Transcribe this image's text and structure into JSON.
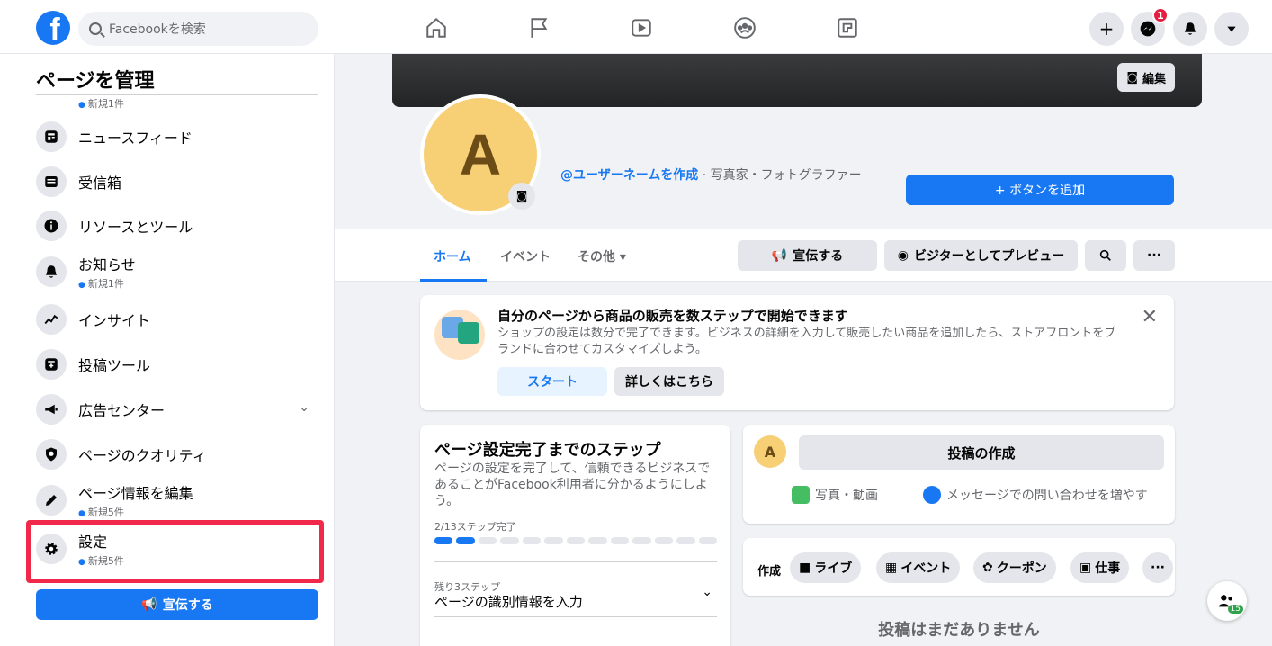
{
  "topbar": {
    "search_placeholder": "Facebookを検索",
    "messenger_badge": "1"
  },
  "sidebar": {
    "title": "ページを管理",
    "top_sub": "新規1件",
    "items": [
      {
        "label": "ニュースフィード",
        "sub": ""
      },
      {
        "label": "受信箱",
        "sub": ""
      },
      {
        "label": "リソースとツール",
        "sub": ""
      },
      {
        "label": "お知らせ",
        "sub": "新規1件"
      },
      {
        "label": "インサイト",
        "sub": ""
      },
      {
        "label": "投稿ツール",
        "sub": ""
      },
      {
        "label": "広告センター",
        "sub": ""
      },
      {
        "label": "ページのクオリティ",
        "sub": ""
      },
      {
        "label": "ページ情報を編集",
        "sub": "新規5件"
      },
      {
        "label": "設定",
        "sub": "新規5件"
      }
    ],
    "promote_label": "宣伝する"
  },
  "profile": {
    "edit_cover_label": "編集",
    "avatar_letter": "A",
    "username_link": "@ユーザーネームを作成",
    "category": " · 写真家・フォトグラファー",
    "add_button_label": "+ ボタンを追加",
    "tabs": [
      "ホーム",
      "イベント",
      "その他 ▾"
    ],
    "actions": {
      "promote": "宣伝する",
      "preview": "ビジターとしてプレビュー",
      "more": "···"
    }
  },
  "shop_card": {
    "title": "自分のページから商品の販売を数ステップで開始できます",
    "description": "ショップの設定は数分で完了できます。ビジネスの詳細を入力して販売したい商品を追加したら、ストアフロントをブランドに合わせてカスタマイズしよう。",
    "start_label": "スタート",
    "more_label": "詳しくはこちら"
  },
  "steps_card": {
    "title": "ページ設定完了までのステップ",
    "description": "ページの設定を完了して、信頼できるビジネスであることがFacebook利用者に分かるようにしよう。",
    "progress_text": "2/13ステップ完了",
    "steps_done": 2,
    "steps_total": 13,
    "remaining_label": "残り3ステップ",
    "remaining_value": "ページの識別情報を入力"
  },
  "composer": {
    "avatar_letter": "A",
    "prompt": "投稿の作成",
    "photo_video": "写真・動画",
    "messages": "メッセージでの問い合わせを増やす"
  },
  "create_bar": {
    "label": "作成",
    "live": "ライブ",
    "event": "イベント",
    "coupon": "クーポン",
    "job": "仕事",
    "more": "···"
  },
  "empty_state": "投稿はまだありません",
  "people_count": "15",
  "colors": {
    "accent": "#1877f2",
    "highlight": "#f02849"
  }
}
